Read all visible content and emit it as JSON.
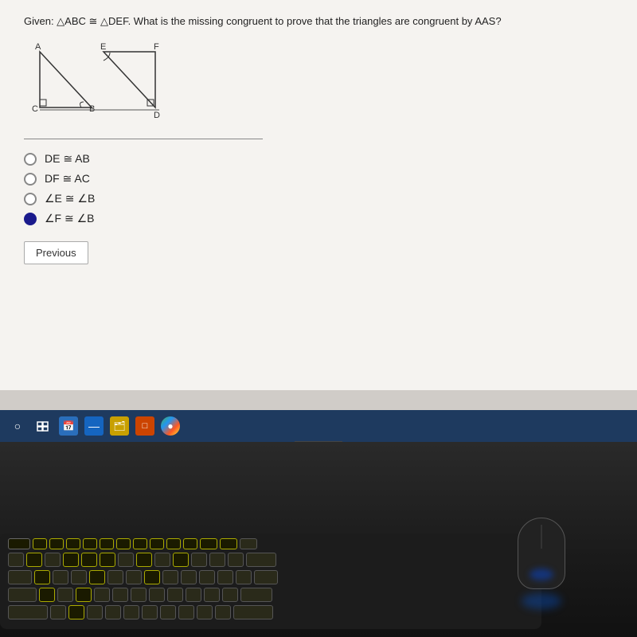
{
  "question": {
    "text": "Given: △ABC ≅ △DEF. What is the missing congruent to prove that the triangles are congruent by AAS?",
    "answers": [
      {
        "id": "a",
        "label": "DE ≅ AB",
        "selected": false
      },
      {
        "id": "b",
        "label": "DF ≅ AC",
        "selected": false
      },
      {
        "id": "c",
        "label": "∠E ≅ ∠B",
        "selected": false
      },
      {
        "id": "d",
        "label": "∠F ≅ ∠B",
        "selected": true
      }
    ]
  },
  "buttons": {
    "previous": "Previous"
  },
  "taskbar": {
    "icons": [
      "○",
      "⊞",
      "📅",
      "—",
      "🗂",
      "□",
      "🌐"
    ]
  }
}
